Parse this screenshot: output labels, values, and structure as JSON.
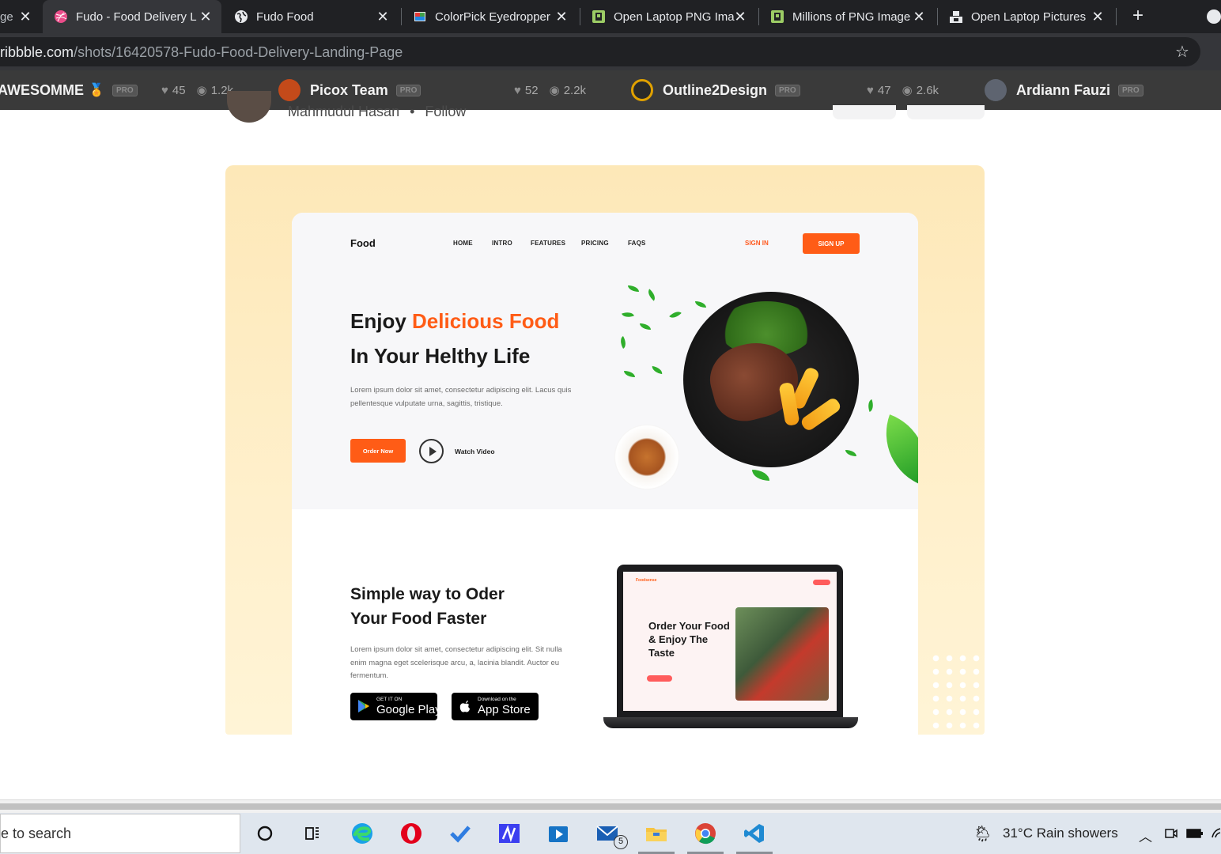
{
  "browser": {
    "tabs": [
      {
        "title": "ge",
        "favicon": "generic-icon",
        "active": false
      },
      {
        "title": "Fudo - Food Delivery L",
        "favicon": "dribbble-icon",
        "active": true
      },
      {
        "title": "Fudo Food",
        "favicon": "globe-icon",
        "active": false
      },
      {
        "title": "ColorPick Eyedropper",
        "favicon": "colorpick-icon",
        "active": false
      },
      {
        "title": "Open Laptop PNG Ima",
        "favicon": "pngwing-icon",
        "active": false
      },
      {
        "title": "Millions of PNG Image",
        "favicon": "pngwing-icon",
        "active": false
      },
      {
        "title": "Open Laptop Pictures",
        "favicon": "unsplash-icon",
        "active": false
      }
    ],
    "close_glyph": "✕",
    "new_tab_glyph": "+",
    "url_host": "dribbble.com",
    "url_path": "/shots/16420578-Fudo-Food-Delivery-Landing-Page",
    "url_prefix_visible": "d"
  },
  "shot_strip": [
    {
      "name": "AWESOMME",
      "badge": "PRO",
      "likes": "45",
      "views": "1.2k"
    },
    {
      "name": "Picox Team",
      "badge": "PRO",
      "likes": "52",
      "views": "2.2k"
    },
    {
      "name": "Outline2Design",
      "badge": "PRO",
      "likes": "47",
      "views": "2.6k"
    },
    {
      "name": "Ardiann Fauzi",
      "badge": "PRO"
    }
  ],
  "author": {
    "name": "Mahmudul Hasan",
    "separator": "•",
    "follow": "Follow"
  },
  "shot": {
    "brand": "Food",
    "nav": [
      "HOME",
      "INTRO",
      "FEATURES",
      "PRICING",
      "FAQS"
    ],
    "sign_in": "SIGN IN",
    "sign_up": "SIGN UP",
    "hero_line1_a": "Enjoy ",
    "hero_line1_b": "Delicious Food",
    "hero_line2": "In Your Helthy Life",
    "hero_text": "Lorem ipsum dolor sit amet, consectetur adipiscing elit. Lacus quis pellentesque vulputate urna, sagittis, tristique.",
    "order_now": "Order Now",
    "watch_video": "Watch Video",
    "section2_line1": "Simple way to Oder",
    "section2_line2": "Your Food Faster",
    "section2_text": "Lorem ipsum dolor sit amet, consectetur adipiscing elit. Sit nulla enim magna eget scelerisque arcu, a, lacinia blandit. Auctor eu fermentum.",
    "google_small": "GET IT ON",
    "google_big": "Google Play",
    "apple_small": "Download on the",
    "apple_big": "App Store",
    "laptop_title": "Order Your Food & Enjoy The Taste",
    "laptop_brand": "Foodsense",
    "accent_color": "#ff5c16"
  },
  "taskbar": {
    "search_placeholder": "e to search",
    "mail_badge": "5",
    "weather": "31°C  Rain showers",
    "apps": [
      "cortana-icon",
      "task-view-icon",
      "edge-icon",
      "opera-icon",
      "todo-icon",
      "app-icon",
      "media-icon",
      "mail-icon",
      "file-explorer-icon",
      "chrome-icon",
      "vscode-icon"
    ]
  }
}
